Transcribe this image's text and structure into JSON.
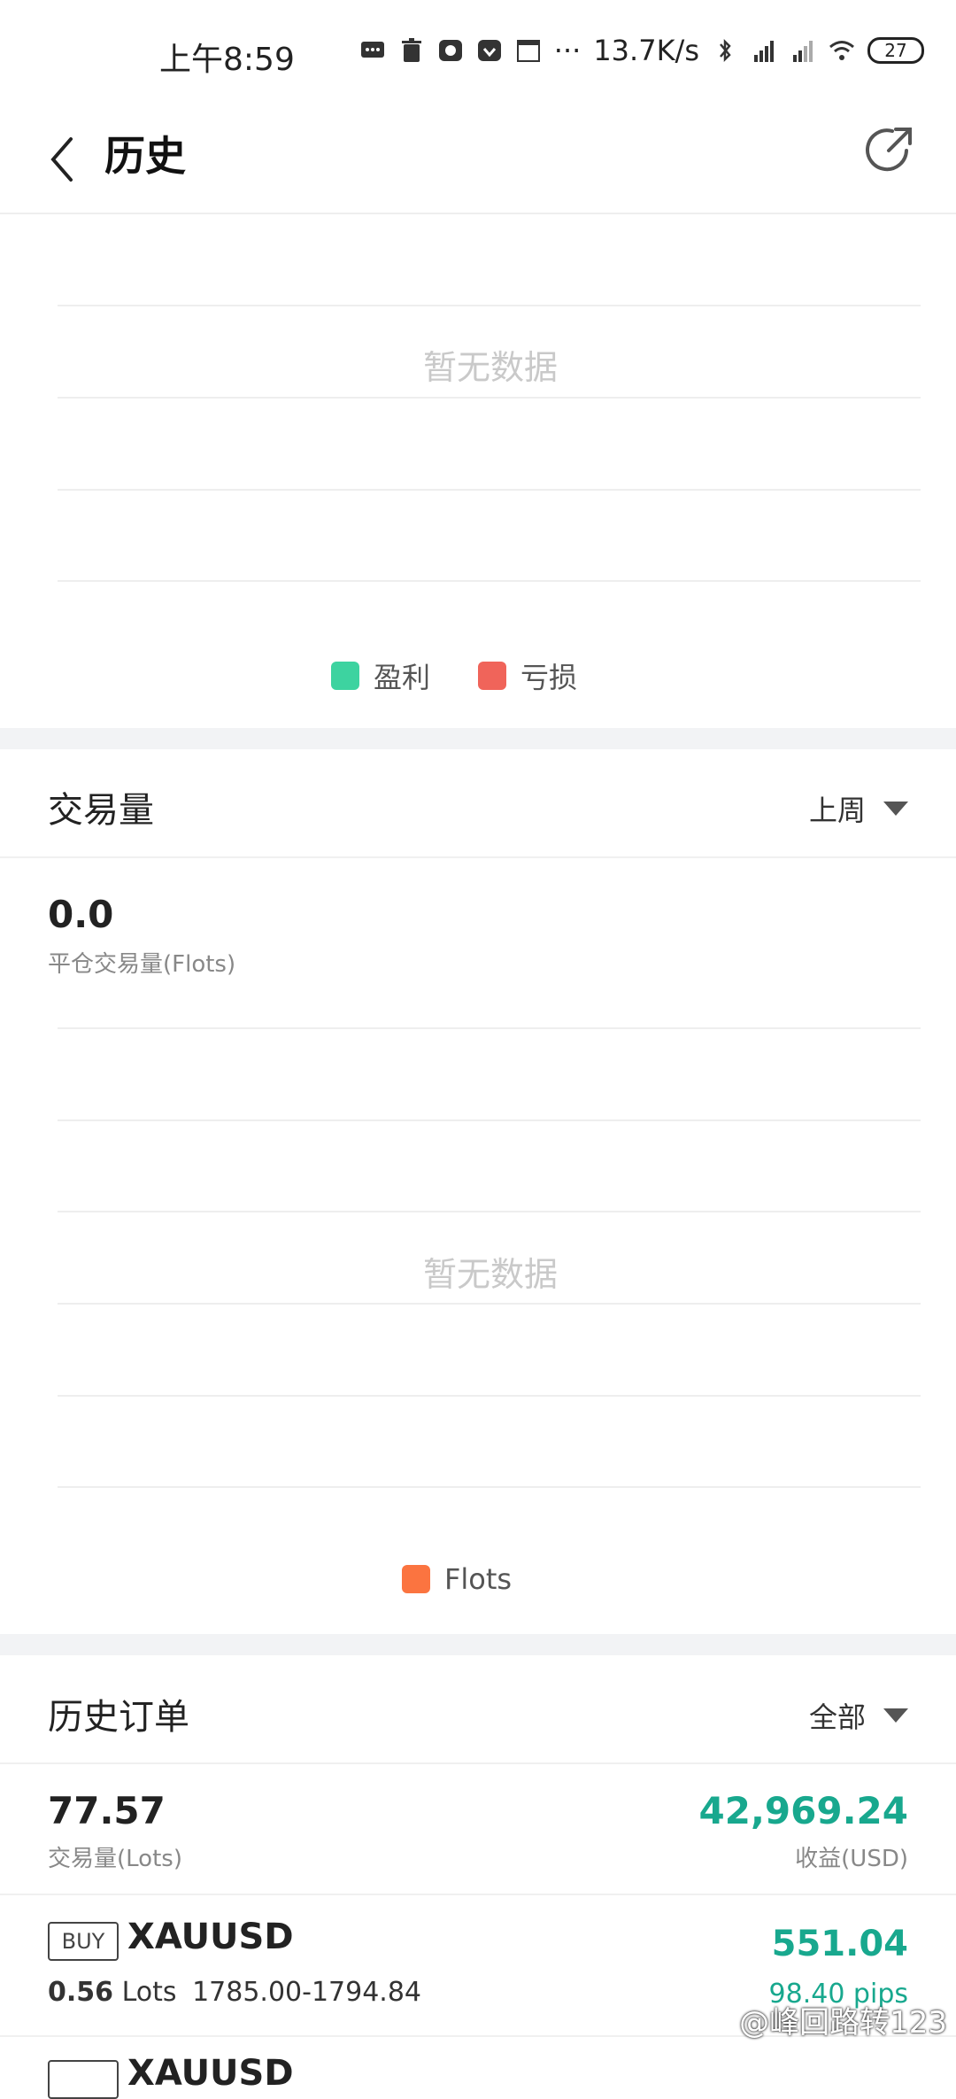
{
  "status_bar": {
    "time": "上午8:59",
    "more": "···",
    "net_speed": "13.7K/s",
    "battery": "27"
  },
  "header": {
    "title": "历史"
  },
  "profit_chart": {
    "empty_text": "暂无数据",
    "legend": [
      {
        "label": "盈利",
        "color": "#3dd3a0"
      },
      {
        "label": "亏损",
        "color": "#f0645a"
      }
    ]
  },
  "volume": {
    "title": "交易量",
    "period": "上周",
    "value": "0.0",
    "value_label": "平仓交易量(Flots)",
    "empty_text": "暂无数据",
    "legend": [
      {
        "label": "Flots",
        "color": "#fb7440"
      }
    ]
  },
  "orders": {
    "title": "历史订单",
    "filter": "全部",
    "summary": {
      "lots": "77.57",
      "lots_label": "交易量(Lots)",
      "profit": "42,969.24",
      "profit_label": "收益(USD)"
    },
    "items": [
      {
        "side": "BUY",
        "symbol": "XAUUSD",
        "lots_value": "0.56",
        "lots_unit": "Lots",
        "price_range": "1785.00-1794.84",
        "profit": "551.04",
        "pips": "98.40 pips"
      },
      {
        "side": "",
        "symbol": "XAUUSD"
      }
    ]
  },
  "watermark": "@峰回路转123",
  "colors": {
    "accent_green": "#18a88e",
    "profit_swatch": "#3dd3a0",
    "loss_swatch": "#f0645a",
    "flots_swatch": "#fb7440"
  }
}
